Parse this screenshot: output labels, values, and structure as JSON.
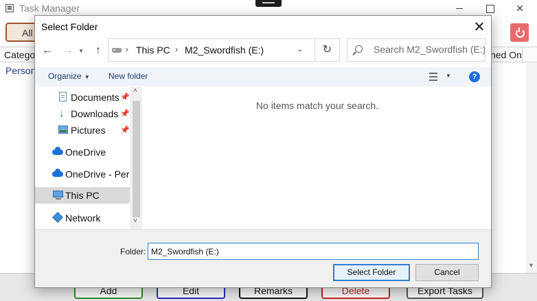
{
  "background_app": {
    "title": "Task Manager",
    "filter_button": "All",
    "columns": {
      "category": "Catego",
      "date": "ned On"
    },
    "rows": [
      {
        "category": "Persona"
      }
    ],
    "bottom_buttons": {
      "add": "Add",
      "edit": "Edit",
      "remarks": "Remarks",
      "delete": "Delete",
      "export": "Export Tasks"
    }
  },
  "dialog": {
    "title": "Select Folder",
    "address": {
      "crumbs": [
        "This PC",
        "M2_Swordfish (E:)"
      ]
    },
    "search": {
      "placeholder": "Search M2_Swordfish (E:)"
    },
    "command_bar": {
      "organize": "Organize",
      "new_folder": "New folder"
    },
    "nav_items": [
      {
        "label": "Documents",
        "icon": "document-icon",
        "pinned": true
      },
      {
        "label": "Downloads",
        "icon": "download-icon",
        "pinned": true
      },
      {
        "label": "Pictures",
        "icon": "pictures-icon",
        "pinned": true
      },
      {
        "label": "OneDrive",
        "icon": "cloud-icon"
      },
      {
        "label": "OneDrive - Per",
        "icon": "cloud-icon"
      },
      {
        "label": "This PC",
        "icon": "computer-icon",
        "selected": true
      },
      {
        "label": "Network",
        "icon": "network-icon"
      }
    ],
    "empty_message": "No items match your search.",
    "folder": {
      "label": "Folder:",
      "value": "M2_Swordfish (E:)"
    },
    "buttons": {
      "select": "Select Folder",
      "cancel": "Cancel"
    }
  },
  "colors": {
    "accent": "#2d7fd3",
    "selected_nav": "#d9d9d9",
    "command_bar": "#f0f4f9"
  }
}
